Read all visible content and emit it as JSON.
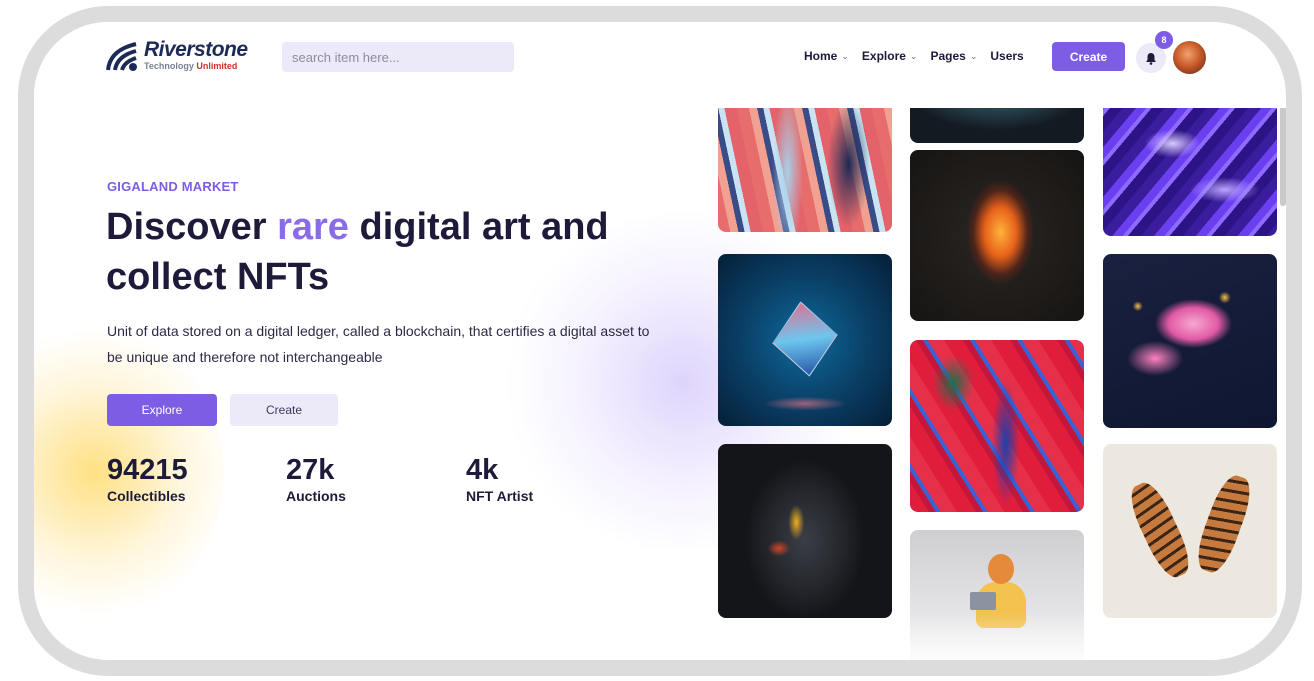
{
  "brand": {
    "name": "Riverstone",
    "tagline_prefix": "Technology",
    "tagline_accent": "Unlimited",
    "accent_color": "#7c5de3"
  },
  "search": {
    "placeholder": "search item here..."
  },
  "nav": [
    {
      "label": "Home",
      "has_dropdown": true
    },
    {
      "label": "Explore",
      "has_dropdown": true
    },
    {
      "label": "Pages",
      "has_dropdown": true
    },
    {
      "label": "Users",
      "has_dropdown": false
    }
  ],
  "header_actions": {
    "create_label": "Create",
    "notification_count": "8",
    "bell_icon": "bell-icon",
    "avatar": "user-avatar"
  },
  "hero": {
    "eyebrow": "GIGALAND MARKET",
    "headline_before": "Discover ",
    "headline_highlight": "rare",
    "headline_after": " digital art and collect NFTs",
    "description": "Unit of data stored on a digital ledger, called a blockchain, that certifies a digital asset to be unique and therefore not interchangeable",
    "primary_button": "Explore",
    "secondary_button": "Create"
  },
  "stats": [
    {
      "value": "94215",
      "label": "Collectibles"
    },
    {
      "value": "27k",
      "label": "Auctions"
    },
    {
      "value": "4k",
      "label": "NFT Artist"
    }
  ],
  "gallery": [
    "marble-art",
    "sphere-art",
    "purple-fluid-art",
    "glass-cube-art",
    "ember-art",
    "pink-splash-art",
    "red-fluid-art",
    "painted-face-art",
    "tigers-art",
    "girl-laptop-art"
  ]
}
